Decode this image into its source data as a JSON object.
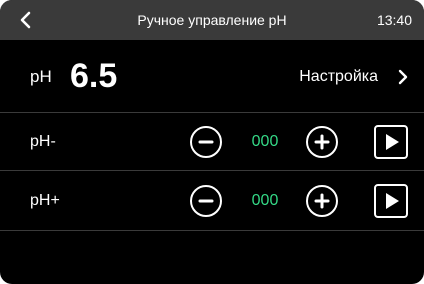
{
  "header": {
    "back_icon": "chevron-left-icon",
    "title": "Ручное управление pH",
    "time": "13:40",
    "background_color": "#3a3a3a"
  },
  "ph_row": {
    "label": "pH",
    "value": "6.5",
    "settings_label": "Настройка",
    "settings_icon": "chevron-right-icon"
  },
  "dosing": [
    {
      "label": "pH-",
      "value": "000",
      "decrease_icon": "minus-circle-icon",
      "increase_icon": "plus-circle-icon",
      "start_icon": "play-icon"
    },
    {
      "label": "pH+",
      "value": "000",
      "decrease_icon": "minus-circle-icon",
      "increase_icon": "plus-circle-icon",
      "start_icon": "play-icon"
    }
  ],
  "colors": {
    "background": "#000000",
    "accent_value": "#34d886",
    "divider": "#3a3a3a"
  }
}
